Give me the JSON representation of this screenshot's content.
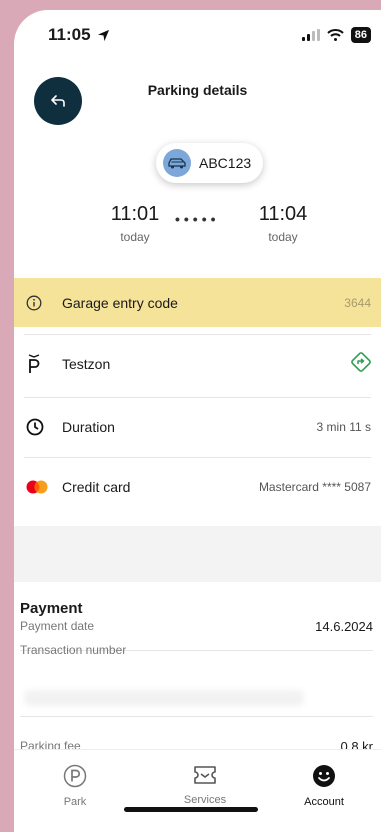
{
  "status_bar": {
    "time": "11:05",
    "battery": "86"
  },
  "header": {
    "title": "Parking details"
  },
  "vehicle": {
    "plate": "ABC123"
  },
  "times": {
    "start": "11:01",
    "start_day": "today",
    "end": "11:04",
    "end_day": "today",
    "separator": "•••••"
  },
  "entry_code": {
    "label": "Garage entry code",
    "value": "3644"
  },
  "zone": {
    "label": "Testzon"
  },
  "duration": {
    "label": "Duration",
    "value": "3 min 11 s"
  },
  "payment_method": {
    "label": "Credit card",
    "value": "Mastercard **** 5087"
  },
  "payment": {
    "title": "Payment",
    "date_label": "Payment date",
    "date_value": "14.6.2024",
    "transaction_label": "Transaction number",
    "fee_label": "Parking fee",
    "fee_value": "0.8 kr"
  },
  "nav": [
    {
      "label": "Park",
      "icon": "parking-icon"
    },
    {
      "label": "Services",
      "icon": "ticket-icon"
    },
    {
      "label": "Account",
      "icon": "smiley-icon"
    }
  ],
  "colors": {
    "entry_code_bg": "#f6e39a",
    "back_button_bg": "#0f2f3f",
    "navigate_green": "#2e9e4f",
    "car_badge_blue": "#7ba7d9"
  }
}
